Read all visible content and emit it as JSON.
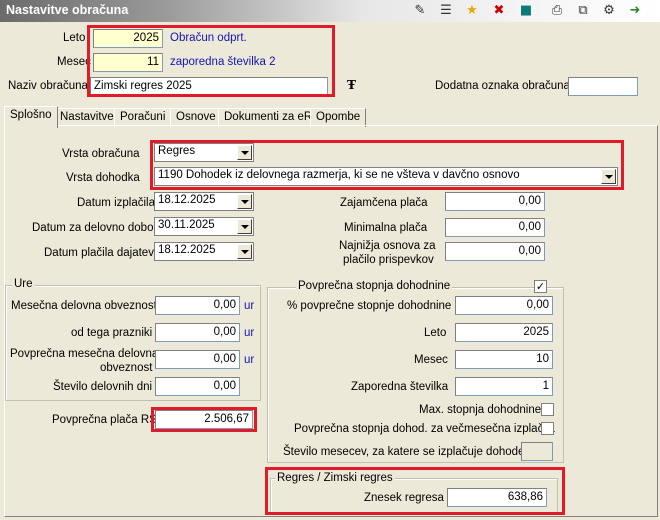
{
  "window": {
    "title": "Nastavitve obračuna"
  },
  "toolbar": {
    "icons": [
      "edit-icon",
      "list-icon",
      "star-icon",
      "delete-icon",
      "cube-icon",
      "print-icon",
      "copy-icon",
      "export-icon"
    ]
  },
  "header": {
    "leto_label": "Leto",
    "leto_value": "2025",
    "leto_note": "Obračun odprt.",
    "mesec_label": "Mesec",
    "mesec_value": "11",
    "mesec_note": "zaporedna številka 2",
    "naziv_label": "Naziv obračuna",
    "naziv_value": "Zimski regres 2025",
    "dodatna_label": "Dodatna oznaka obračuna",
    "dodatna_value": ""
  },
  "tabs": [
    {
      "label": "Splošno",
      "active": true
    },
    {
      "label": "Nastavitve"
    },
    {
      "label": "Poračuni"
    },
    {
      "label": "Osnove"
    },
    {
      "label": "Dokumenti za eR"
    },
    {
      "label": "Opombe"
    }
  ],
  "general": {
    "vrsta_obracuna_label": "Vrsta obračuna",
    "vrsta_obracuna_value": "Regres",
    "vrsta_dohodka_label": "Vrsta dohodka",
    "vrsta_dohodka_value": "1190  Dohodek iz delovnega razmerja, ki se ne všteva v davčno osnovo",
    "datum_izplacila_label": "Datum izplačila",
    "datum_izplacila_value": "18.12.2025",
    "datum_delovno_label": "Datum za delovno dobo",
    "datum_delovno_value": "30.11.2025",
    "datum_dajatev_label": "Datum plačila dajatev",
    "datum_dajatev_value": "18.12.2025",
    "zajamcena_label": "Zajamčena plača",
    "zajamcena_value": "0,00",
    "minimalna_label": "Minimalna plača",
    "minimalna_value": "0,00",
    "najnizja_label_1": "Najnižja osnova za",
    "najnizja_label_2": "plačilo prispevkov",
    "najnizja_value": "0,00"
  },
  "ure": {
    "title": "Ure",
    "mesecna_label": "Mesečna delovna obveznost",
    "mesecna_value": "0,00",
    "prazniki_label": "od tega prazniki",
    "prazniki_value": "0,00",
    "povprecna_label_1": "Povprečna mesečna delovna",
    "povprecna_label_2": "obveznost",
    "povprecna_value": "0,00",
    "dni_label": "Število delovnih dni",
    "dni_value": "0,00",
    "unit": "ur"
  },
  "placa": {
    "label": "Povprečna plača RS",
    "value": "2.506,67"
  },
  "stopnja": {
    "title": "Povprečna stopnja dohodnine",
    "checked": "✓",
    "pct_label": "% povprečne stopnje dohodnine",
    "pct_value": "0,00",
    "leto_label": "Leto",
    "leto_value": "2025",
    "mesec_label": "Mesec",
    "mesec_value": "10",
    "zap_label": "Zaporedna številka",
    "zap_value": "1",
    "max_label": "Max. stopnja dohodnine",
    "vecmesecna_label": "Povprečna stopnja dohod. za večmesečna izplačila",
    "stevilo_label": "Število mesecev, za katere se izplačuje dohodek",
    "stevilo_value": ""
  },
  "regres": {
    "title": "Regres / Zimski regres",
    "znesek_label": "Znesek regresa",
    "znesek_value": "638,86"
  },
  "colors": {
    "highlight": "#e01b2a",
    "note": "#1414b4",
    "background": "#ece9d8"
  }
}
